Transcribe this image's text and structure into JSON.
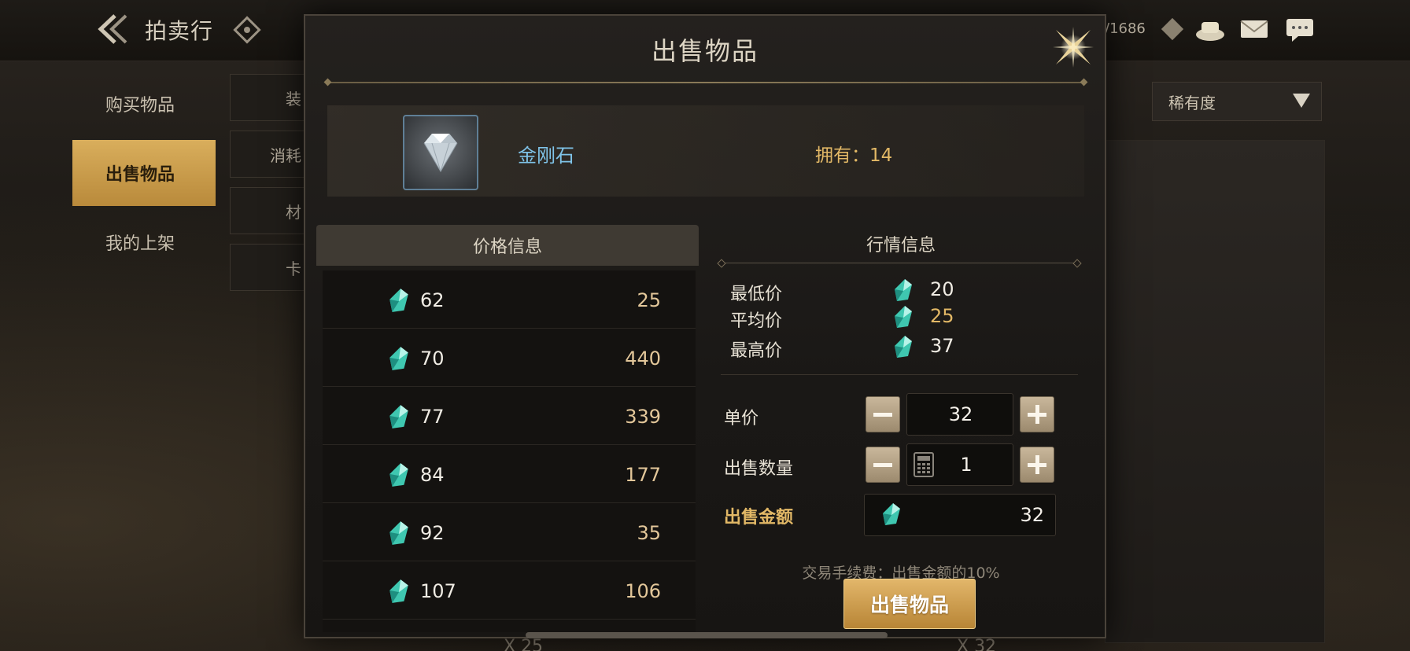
{
  "background": {
    "title": "拍卖行",
    "currency_readout": "/1686",
    "side_nav": [
      {
        "label": "购买物品",
        "active": false
      },
      {
        "label": "出售物品",
        "active": true
      },
      {
        "label": "我的上架",
        "active": false
      }
    ],
    "sub_tabs": [
      "装",
      "消耗",
      "材",
      "卡"
    ],
    "rarity_dropdown": "稀有度",
    "bottom_counts": [
      "X 25",
      "X 32"
    ]
  },
  "modal": {
    "title": "出售物品",
    "item": {
      "name": "金刚石",
      "owned_label": "拥有：",
      "owned_count": "14"
    },
    "price_info": {
      "header": "价格信息",
      "rows": [
        {
          "price": "62",
          "qty": "25"
        },
        {
          "price": "70",
          "qty": "440"
        },
        {
          "price": "77",
          "qty": "339"
        },
        {
          "price": "84",
          "qty": "177"
        },
        {
          "price": "92",
          "qty": "35"
        },
        {
          "price": "107",
          "qty": "106"
        }
      ]
    },
    "market_info": {
      "header": "行情信息",
      "lowest_label": "最低价",
      "lowest_value": "20",
      "average_label": "平均价",
      "average_value": "25",
      "highest_label": "最高价",
      "highest_value": "37"
    },
    "form": {
      "unit_price_label": "单价",
      "unit_price_value": "32",
      "quantity_label": "出售数量",
      "quantity_value": "1",
      "total_label": "出售金额",
      "total_value": "32",
      "fee_note": "交易手续费：出售金额的10%",
      "sell_button": "出售物品"
    },
    "colors": {
      "accent_gold": "#e2b866",
      "item_name_blue": "#7fc3e8",
      "gem_teal": "#3fc7b0"
    }
  },
  "icons": {
    "back": "back-arrow-icon",
    "help": "diamond-help-icon",
    "close": "star-close-icon",
    "currency": "teal-gem-icon",
    "calculator": "calculator-icon",
    "mail": "mail-icon",
    "chat": "chat-icon",
    "chest": "treasure-icon"
  }
}
